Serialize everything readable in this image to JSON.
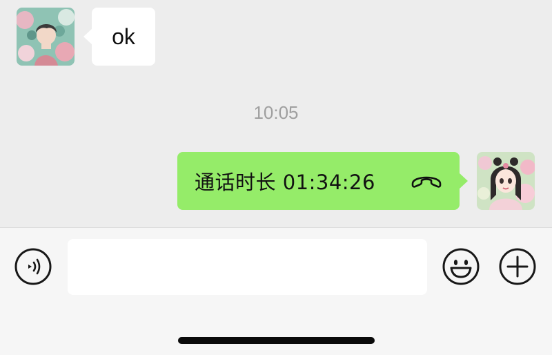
{
  "messages": [
    {
      "direction": "incoming",
      "type": "text",
      "text": "ok"
    },
    {
      "direction": "outgoing",
      "type": "call_record",
      "text": "通话时长 01:34:26",
      "icon": "hang-up-phone-icon"
    }
  ],
  "timestamp": "10:05",
  "input": {
    "value": "",
    "placeholder": ""
  },
  "icons": {
    "voice": "voice-mode-icon",
    "emoji": "emoji-icon",
    "more": "plus-icon"
  },
  "colors": {
    "background": "#ededed",
    "incoming_bubble": "#ffffff",
    "outgoing_bubble": "#95ec69",
    "input_bar": "#f6f6f6",
    "timestamp_text": "#9f9f9f"
  }
}
